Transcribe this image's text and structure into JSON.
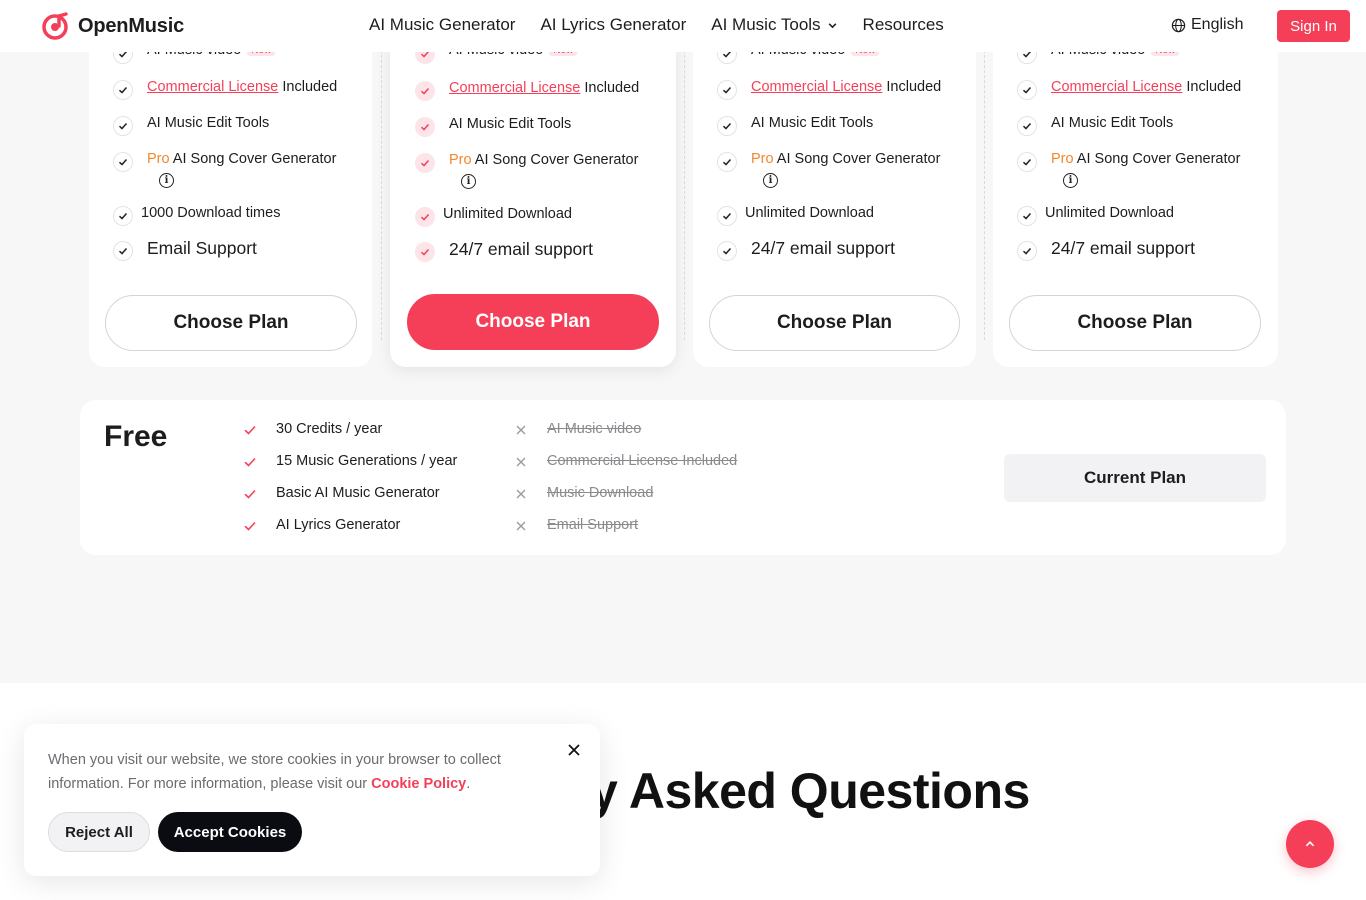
{
  "header": {
    "brand": "OpenMusic",
    "nav": [
      "AI Music Generator",
      "AI Lyrics Generator",
      "AI Music Tools",
      "Resources"
    ],
    "language": "English",
    "sign_in": "Sign In"
  },
  "colors": {
    "accent": "#f53f58",
    "pro": "#f5862b",
    "dark": "#0b0b12"
  },
  "plans": [
    {
      "video": "AI Music video",
      "new_tag": "New",
      "license_link": "Commercial License",
      "license_rest": " Included",
      "edit_tools": "AI Music Edit Tools",
      "pro": "Pro",
      "cover": " AI Song Cover Generator",
      "download": "1000 Download times",
      "support": "Email Support",
      "button": "Choose Plan"
    },
    {
      "video": "AI Music video",
      "new_tag": "New",
      "license_link": "Commercial License",
      "license_rest": " Included",
      "edit_tools": "AI Music Edit Tools",
      "pro": "Pro",
      "cover": " AI Song Cover Generator",
      "download": "Unlimited Download",
      "support": "24/7 email support",
      "button": "Choose Plan"
    },
    {
      "video": "AI Music video",
      "new_tag": "New",
      "license_link": "Commercial License",
      "license_rest": " Included",
      "edit_tools": "AI Music Edit Tools",
      "pro": "Pro",
      "cover": " AI Song Cover Generator",
      "download": "Unlimited Download",
      "support": "24/7 email support",
      "button": "Choose Plan"
    },
    {
      "video": "AI Music video",
      "new_tag": "New",
      "license_link": "Commercial License",
      "license_rest": " Included",
      "edit_tools": "AI Music Edit Tools",
      "pro": "Pro",
      "cover": " AI Song Cover Generator",
      "download": "Unlimited Download",
      "support": "24/7 email support",
      "button": "Choose Plan"
    }
  ],
  "free": {
    "title": "Free",
    "included": [
      "30 Credits / year",
      "15 Music Generations / year",
      "Basic AI Music Generator",
      "AI Lyrics Generator"
    ],
    "excluded": [
      "AI Music video",
      "Commercial License Included",
      "Music Download",
      "Email Support"
    ],
    "button": "Current Plan"
  },
  "faq": {
    "title_visible": "y Asked Questions"
  },
  "cookie": {
    "text": "When you visit our website, we store cookies in your browser to collect information. For more information, please visit our ",
    "link": "Cookie Policy",
    "end": ".",
    "reject": "Reject All",
    "accept": "Accept Cookies"
  }
}
